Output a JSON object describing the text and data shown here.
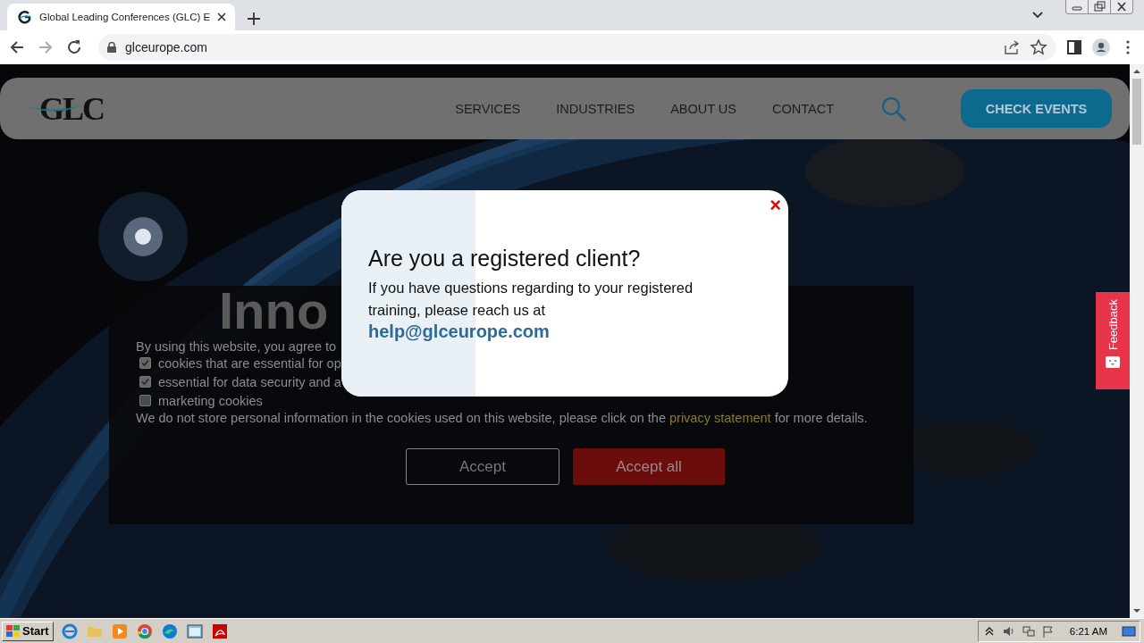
{
  "browser": {
    "tab": {
      "title": "Global Leading Conferences (GLC) E",
      "selected": true
    },
    "address": "glceurope.com"
  },
  "header": {
    "logo": "GLC",
    "nav": [
      {
        "label": "SERVICES"
      },
      {
        "label": "INDUSTRIES"
      },
      {
        "label": "ABOUT US"
      },
      {
        "label": "CONTACT"
      }
    ],
    "cta": "CHECK EVENTS"
  },
  "hero": {
    "headline": "Inno"
  },
  "cookie_notice": {
    "intro": "By using this website, you agree to",
    "options": [
      {
        "label": "cookies that are essential for op",
        "checked": true
      },
      {
        "label": "essential for data security and a",
        "checked": true
      },
      {
        "label": "marketing cookies",
        "checked": false
      }
    ],
    "note_before": "We do not store personal information in the cookies used on this website, please click on the",
    "link": "privacy statement",
    "note_after": "for more details.",
    "buttons": [
      {
        "label": "Accept",
        "kind": "outline"
      },
      {
        "label": "Accept all",
        "kind": "filled"
      }
    ]
  },
  "modal": {
    "close": "×",
    "title": "Are you a registered client?",
    "text": "If you have questions regarding to your registered training, please reach us at",
    "email": "help@glceurope.com"
  },
  "feedback": {
    "label": "Feedback"
  },
  "taskbar": {
    "start": "Start",
    "clock": "6:21 AM"
  }
}
